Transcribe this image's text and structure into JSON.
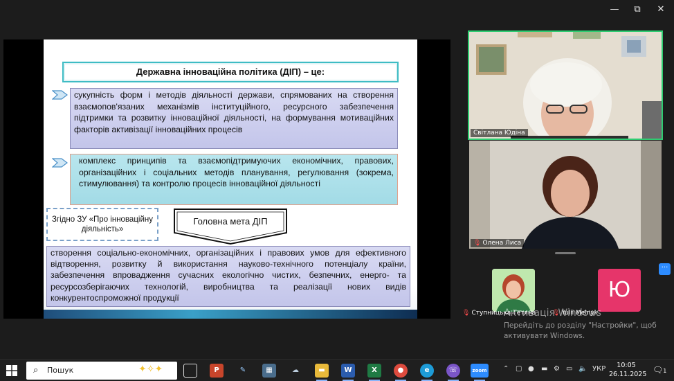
{
  "window_controls": {
    "minimize": "—",
    "restore": "⧉",
    "close": "✕"
  },
  "slide": {
    "title": "Державна інноваційна політика (ДІП) – це:",
    "item1": "сукупність форм і методів діяльності держави, спрямованих на створення взаємопов'язаних механізмів інституційного, ресурсного забезпечення підтримки та розвитку інноваційної діяльності, на формування мотиваційних факторів активізації інноваційних процесів",
    "item2": "комплекс принципів та взаємопідтримуючих економічних, правових, організаційних і соціальних методів планування, регулювання (зокрема, стимулювання) та контролю процесів інноваційної діяльності",
    "law_note": "Згідно ЗУ «Про інноваційну діяльність»",
    "goal_label": "Головна мета ДІП",
    "goal_text": "створення соціально-економічних, організаційних і правових умов для ефективного відтворення, розвитку й використання науково-технічного потенціалу країни, забезпечення впровадження сучасних екологічно чистих, безпечних, енерго- та ресурсозберігаючих технологій, виробництва та реалізації нових видів конкурентоспроможної продукції"
  },
  "participants": {
    "tile1_name": "Світлана Юдіна",
    "tile2_name": "Олена Лиса",
    "thumb_a_name": "Ступницька Тетяна",
    "thumb_b_name": "Yulii Melnyk",
    "thumb_b_initial": "Ю",
    "more": "···"
  },
  "activation": {
    "title": "Активація Windows",
    "line1": "Перейдіть до розділу \"Настройки\", щоб",
    "line2": "активувати Windows."
  },
  "taskbar": {
    "search_placeholder": "Пошук",
    "language": "УКР",
    "time": "10:05",
    "date": "26.11.2025",
    "notif_count": "1"
  },
  "colors": {
    "accent": "#2ecc71",
    "zoom_blue": "#2d8cff",
    "slide_teal": "#3fbcc4"
  }
}
